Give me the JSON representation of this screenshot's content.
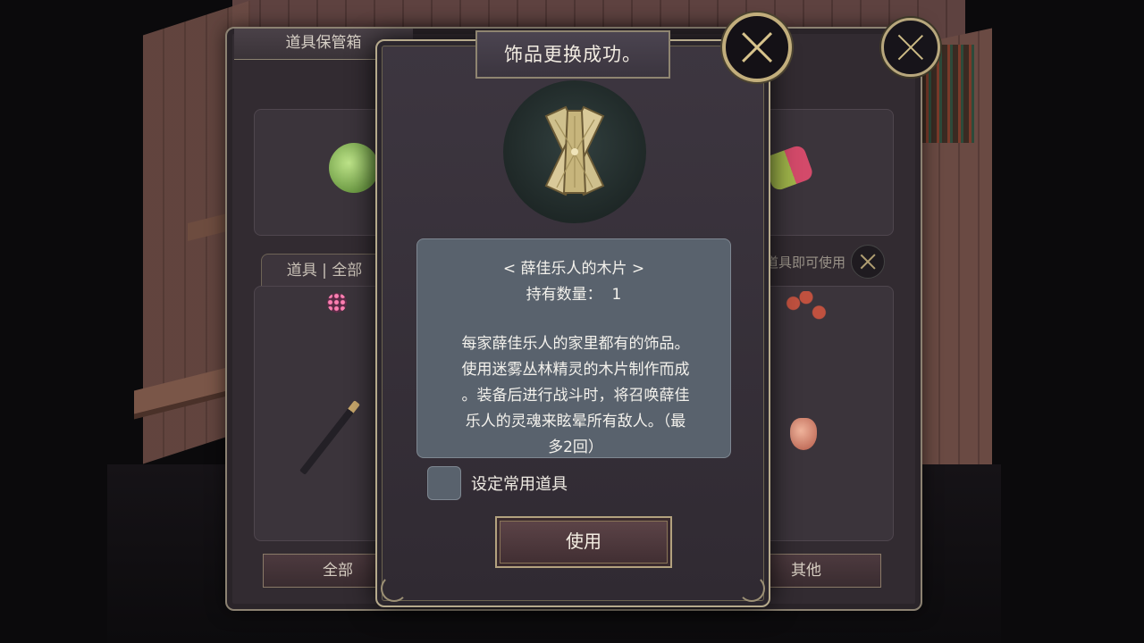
{
  "background": {
    "panel_title": "道具保管箱",
    "tab_label": "道具 | 全部",
    "hint_text": "点击道具即可使用",
    "filters": {
      "all": "全部",
      "other": "其他"
    }
  },
  "dialog": {
    "title": "饰品更换成功。",
    "item_name": "< 薛佳乐人的木片 >",
    "quantity_label": "持有数量：",
    "quantity_value": "1",
    "description": "每家薛佳乐人的家里都有的饰品。\n使用迷雾丛林精灵的木片制作而成\n。装备后进行战斗时，将召唤薛佳\n乐人的灵魂来眩晕所有敌人。（最\n多2回）",
    "checkbox_label": "设定常用道具",
    "use_button": "使用"
  },
  "colors": {
    "accent_gold": "#c2ae7c",
    "panel_bg": "#302a32",
    "desc_bg": "#59626d",
    "button_bg": "#4e3a3e"
  },
  "icons": {
    "close": "close-x-icon",
    "item": "wooden-chip-icon"
  }
}
